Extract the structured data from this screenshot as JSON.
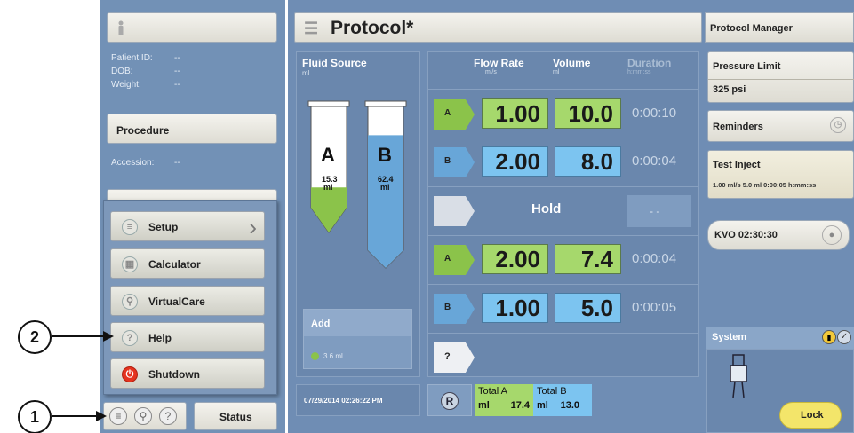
{
  "left": {
    "patient_id_label": "Patient ID:",
    "patient_id_value": "--",
    "dob_label": "DOB:",
    "dob_value": "--",
    "weight_label": "Weight:",
    "weight_value": "--",
    "procedure_label": "Procedure",
    "accession_label": "Accession:",
    "accession_value": "--"
  },
  "menu": {
    "setup": "Setup",
    "calculator": "Calculator",
    "virtualcare": "VirtualCare",
    "help": "Help",
    "shutdown": "Shutdown"
  },
  "bottom": {
    "status": "Status"
  },
  "callouts": {
    "one": "1",
    "two": "2"
  },
  "header": {
    "title": "Protocol*"
  },
  "fluid": {
    "title": "Fluid Source",
    "unit": "ml",
    "syringe_a_label": "A",
    "syringe_a_volume": "15.3",
    "syringe_a_unit": "ml",
    "syringe_a_fill_fraction": 0.2,
    "syringe_b_label": "B",
    "syringe_b_volume": "62.4",
    "syringe_b_unit": "ml",
    "syringe_b_fill_fraction": 0.8,
    "add_label": "Add",
    "add_value": "3.6 ml",
    "datetime": "07/29/2014 02:26:22 PM"
  },
  "columns": {
    "flow_rate": "Flow Rate",
    "flow_rate_unit": "ml/s",
    "volume": "Volume",
    "volume_unit": "ml",
    "duration": "Duration",
    "duration_unit": "h:mm:ss"
  },
  "steps": [
    {
      "tag": "A",
      "flow": "1.00",
      "volume": "10.0",
      "duration": "0:00:10"
    },
    {
      "tag": "B",
      "flow": "2.00",
      "volume": "8.0",
      "duration": "0:00:04"
    },
    {
      "hold": "Hold",
      "duration": "- -"
    },
    {
      "tag": "A",
      "flow": "2.00",
      "volume": "7.4",
      "duration": "0:00:04"
    },
    {
      "tag": "B",
      "flow": "1.00",
      "volume": "5.0",
      "duration": "0:00:05"
    },
    {
      "tag": "?"
    }
  ],
  "totals": {
    "r": "R",
    "total_a_label": "Total A",
    "total_a_unit": "ml",
    "total_a_value": "17.4",
    "total_b_label": "Total B",
    "total_b_unit": "ml",
    "total_b_value": "13.0"
  },
  "right": {
    "protocol_manager": "Protocol Manager",
    "pressure_limit_label": "Pressure Limit",
    "pressure_limit_value": "325 psi",
    "reminders": "Reminders",
    "test_inject_label": "Test Inject",
    "test_inject_value": "1.00 ml/s 5.0 ml 0:00:05 h:mm:ss",
    "kvo": "KVO 02:30:30",
    "system": "System",
    "lock": "Lock"
  },
  "colors": {
    "panel": "#6f8fb5",
    "fluid_a": "#8bc34a",
    "fluid_b": "#68a6d8",
    "lock": "#f3e56a"
  }
}
